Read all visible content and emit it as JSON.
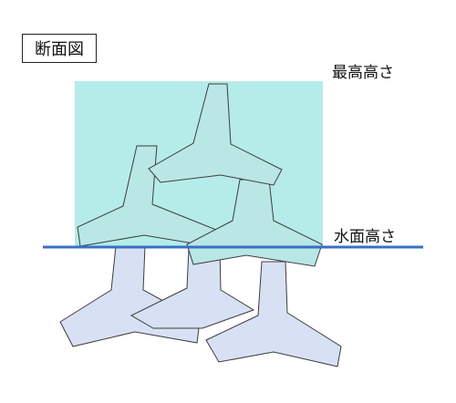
{
  "title": "断面図",
  "labels": {
    "max_height": "最高高さ",
    "water_height": "水面高さ"
  },
  "colors": {
    "region_fill": "#b5ece9",
    "upper_block_fill": "#b8e7e5",
    "lower_block_fill": "#d8e1f4",
    "outline": "#3c3c3c",
    "water_line": "#3a6fc4"
  }
}
